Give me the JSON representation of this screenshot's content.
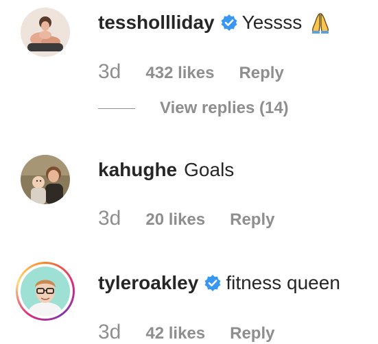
{
  "colors": {
    "text_primary": "#262626",
    "text_secondary": "#8e8e8e",
    "verified_blue": "#3897f0",
    "background": "#ffffff"
  },
  "comments": [
    {
      "username": "tesshollliday",
      "verified": true,
      "text": "Yessss",
      "emoji": "folded-hands-emoji",
      "time": "3d",
      "likes": "432 likes",
      "reply_label": "Reply",
      "view_replies": "View replies (14)"
    },
    {
      "username": "kahughe",
      "verified": false,
      "text": "Goals",
      "time": "3d",
      "likes": "20 likes",
      "reply_label": "Reply"
    },
    {
      "username": "tyleroakley",
      "verified": true,
      "has_story_ring": true,
      "text": "fitness queen",
      "time": "3d",
      "likes": "42 likes",
      "reply_label": "Reply"
    }
  ]
}
